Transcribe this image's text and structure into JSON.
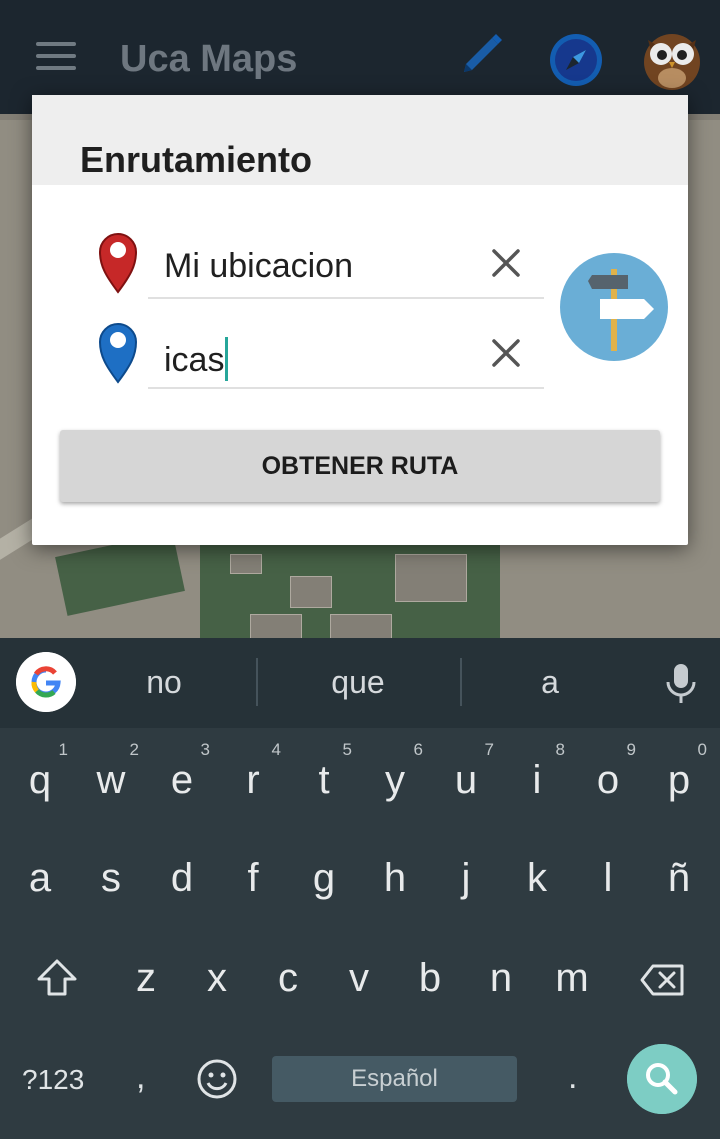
{
  "app": {
    "title": "Uca Maps"
  },
  "dialog": {
    "title": "Enrutamiento",
    "origin_value": "Mi ubicacion",
    "destination_value": "icas",
    "submit_label": "OBTENER RUTA"
  },
  "keyboard": {
    "suggestions": [
      "no",
      "que",
      "a"
    ],
    "row1": [
      {
        "k": "q",
        "n": "1"
      },
      {
        "k": "w",
        "n": "2"
      },
      {
        "k": "e",
        "n": "3"
      },
      {
        "k": "r",
        "n": "4"
      },
      {
        "k": "t",
        "n": "5"
      },
      {
        "k": "y",
        "n": "6"
      },
      {
        "k": "u",
        "n": "7"
      },
      {
        "k": "i",
        "n": "8"
      },
      {
        "k": "o",
        "n": "9"
      },
      {
        "k": "p",
        "n": "0"
      }
    ],
    "row2": [
      "a",
      "s",
      "d",
      "f",
      "g",
      "h",
      "j",
      "k",
      "l",
      "ñ"
    ],
    "row3": [
      "z",
      "x",
      "c",
      "v",
      "b",
      "n",
      "m"
    ],
    "symbols_label": "?123",
    "comma_label": ",",
    "space_label": "Español",
    "period_label": "."
  },
  "colors": {
    "appbar": "#1f2a33",
    "origin_pin": "#c62828",
    "destination_pin": "#1e6fc4",
    "keyboard_bg": "#263238",
    "search_key": "#7dcdc4"
  },
  "icons": [
    "menu-icon",
    "edit-icon",
    "compass-icon",
    "owl-avatar-icon",
    "origin-pin-icon",
    "destination-pin-icon",
    "clear-icon",
    "signpost-icon",
    "google-icon",
    "mic-icon",
    "shift-icon",
    "backspace-icon",
    "emoji-icon",
    "search-icon"
  ]
}
